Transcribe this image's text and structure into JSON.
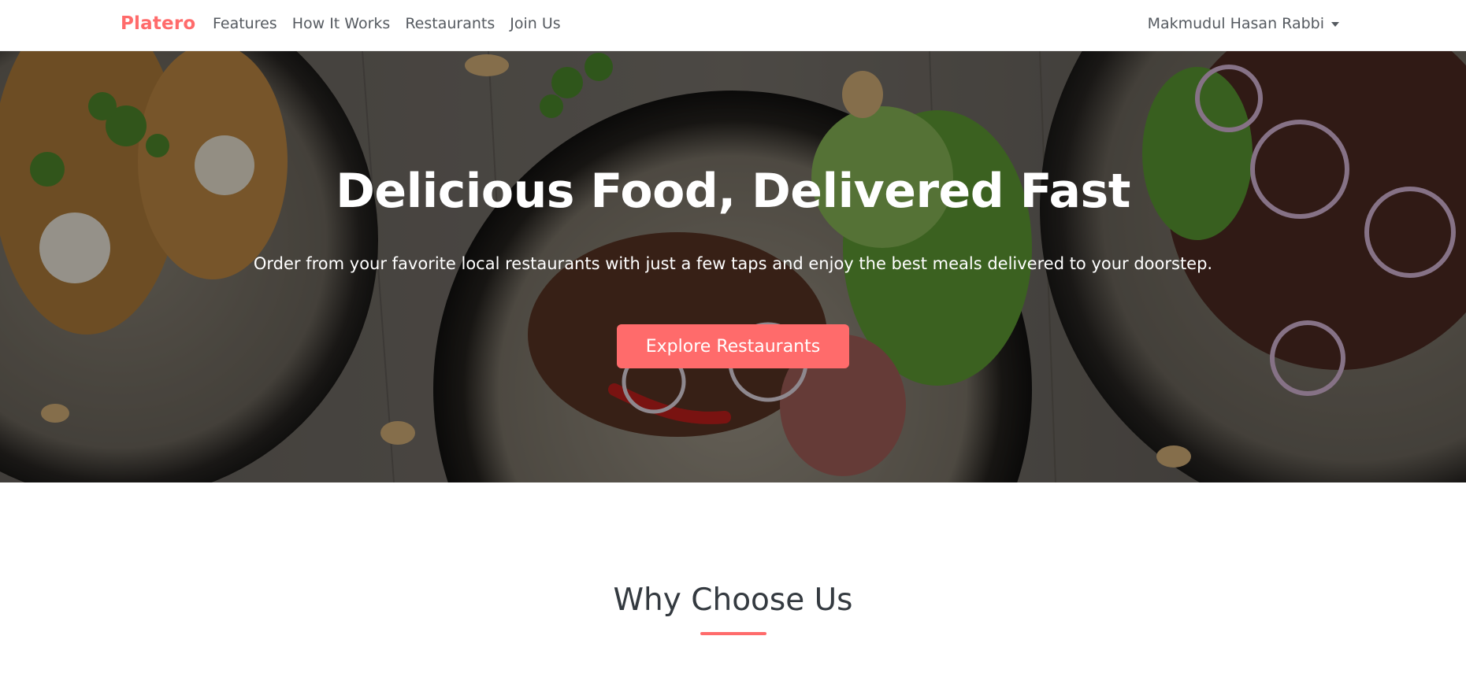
{
  "navbar": {
    "brand": "Platero",
    "links": [
      {
        "label": "Features"
      },
      {
        "label": "How It Works"
      },
      {
        "label": "Restaurants"
      },
      {
        "label": "Join Us"
      }
    ],
    "user": {
      "name": "Makmudul Hasan Rabbi",
      "icon": "caret-down-icon"
    }
  },
  "hero": {
    "title": "Delicious Food, Delivered Fast",
    "subtitle": "Order from your favorite local restaurants with just a few taps and enjoy the best meals delivered to your doorstep.",
    "cta_label": "Explore Restaurants",
    "background": "food-plates-photo"
  },
  "section": {
    "title": "Why Choose Us"
  },
  "colors": {
    "accent": "#ff6b6b",
    "text_dark": "#343a40",
    "nav_text": "#555a60"
  }
}
